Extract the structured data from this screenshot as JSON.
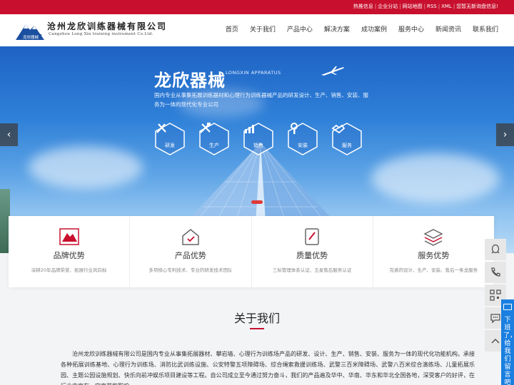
{
  "topbar": {
    "links": [
      "热推信息",
      "企业分站",
      "网站地图",
      "RSS",
      "XML",
      "您暂无新询盘信息!"
    ]
  },
  "header": {
    "logo_badge": "龙欣器械",
    "logo_cn": "沧州龙欣训练器械有限公司",
    "logo_en": "Cangzhou Long Xin training instrument Co.Ltd.",
    "nav": [
      "首页",
      "关于我们",
      "产品中心",
      "解决方案",
      "成功案例",
      "服务中心",
      "新闻资讯",
      "联系我们"
    ]
  },
  "banner": {
    "title": "龙欣器械",
    "subtitle": "LONGXIN APPARATUS",
    "description": "国内专业从事集拓展训练器材和心理行为训练器械产品的研发设计、生产、销售、安装、服务为一体的现代化专业公司",
    "features": [
      {
        "label": "研发",
        "icon": "research-icon"
      },
      {
        "label": "生产",
        "icon": "tools-icon"
      },
      {
        "label": "销售",
        "icon": "chart-icon"
      },
      {
        "label": "安装",
        "icon": "wrench-icon"
      },
      {
        "label": "服务",
        "icon": "handshake-icon"
      }
    ],
    "prev_arrow": "‹",
    "next_arrow": "›"
  },
  "advantages": [
    {
      "title": "品牌优势",
      "desc": "深耕20年品牌荣誉、拓展行业风向标",
      "icon": "brand-icon"
    },
    {
      "title": "产品优势",
      "desc": "多项核心专利技术、专业的研发技术团队",
      "icon": "house-icon"
    },
    {
      "title": "质量优势",
      "desc": "三标管理体系认证、五星售后服务认证",
      "icon": "quality-icon"
    },
    {
      "title": "服务优势",
      "desc": "完善的设计、生产、安装、售后一条龙服务",
      "icon": "layers-icon"
    }
  ],
  "about": {
    "title": "关于我们",
    "text": "沧州龙欣训练器械有限公司是国内专业从事集拓展器材、攀岩墙、心理行为训练场产品的研发、设计、生产、销售、安装、服务为一体的现代化功能机构。承接各种拓展训练基地、心理行为训练场、消防比武训练设施、公安特警五项障碍场、综合绳索救援训练场、武警三百米障碍场、武警八百米综合演练场、儿童拓展乐园、主题公园设施规划、快乐向前冲娱乐项目建设等工程。自公司成立至今通过努力奋斗，我们的产品遍及华中、华南、华东和华北全国各地，深受客户的好评，在行业内享有一定声誉和影响。"
  },
  "float": {
    "consult_label": "下班了，给我们留言吧"
  },
  "colors": {
    "brand_red": "#c8102e",
    "consult_blue": "#1a7fe0"
  }
}
